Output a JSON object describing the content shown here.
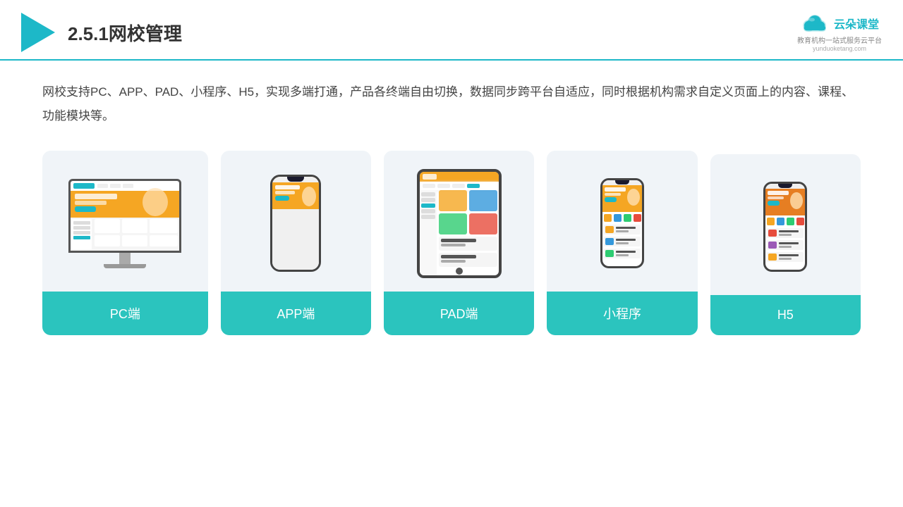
{
  "header": {
    "title": "2.5.1网校管理",
    "brand": {
      "name": "云朵课堂",
      "url": "yunduoketang.com",
      "tagline": "教育机构一站\n式服务云平台"
    }
  },
  "description": "网校支持PC、APP、PAD、小程序、H5，实现多端打通，产品各终端自由切换，数据同步跨平台自适应，同时根据机构需求自定义页面上的内容、课程、功能模块等。",
  "devices": [
    {
      "id": "pc",
      "label": "PC端"
    },
    {
      "id": "app",
      "label": "APP端"
    },
    {
      "id": "pad",
      "label": "PAD端"
    },
    {
      "id": "miniprogram",
      "label": "小程序"
    },
    {
      "id": "h5",
      "label": "H5"
    }
  ],
  "colors": {
    "accent": "#2bc4be",
    "header_line": "#1db8c8",
    "card_bg": "#f0f4f8"
  }
}
